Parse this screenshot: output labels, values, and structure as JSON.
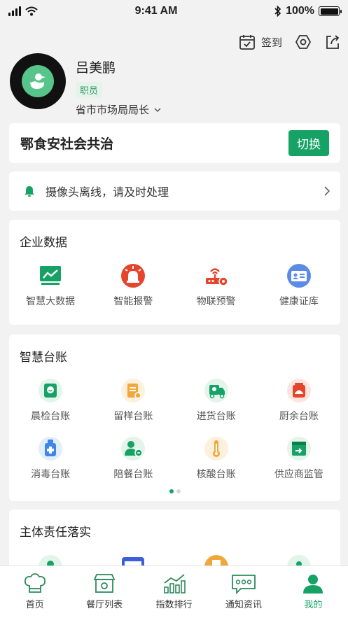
{
  "status_bar": {
    "time": "9:41 AM",
    "battery": "100%"
  },
  "top_actions": {
    "checkin_label": "签到"
  },
  "profile": {
    "name": "吕美鹏",
    "role": "职员",
    "org": "省市市场局局长"
  },
  "platform": {
    "name": "鄂食安社会共治",
    "switch_label": "切换"
  },
  "notice": {
    "text": "摄像头离线，请及时处理"
  },
  "enterprise": {
    "title": "企业数据",
    "items": [
      {
        "label": "智慧大数据",
        "icon": "chart-board-icon"
      },
      {
        "label": "智能报警",
        "icon": "alarm-icon"
      },
      {
        "label": "物联预警",
        "icon": "iot-router-icon"
      },
      {
        "label": "健康证库",
        "icon": "id-card-icon"
      }
    ]
  },
  "ledger": {
    "title": "智慧台账",
    "items": [
      {
        "label": "晨检台账",
        "icon": "morning-check-icon"
      },
      {
        "label": "留样台账",
        "icon": "sample-icon"
      },
      {
        "label": "进货台账",
        "icon": "truck-icon"
      },
      {
        "label": "厨余台账",
        "icon": "kitchen-waste-icon"
      },
      {
        "label": "消毒台账",
        "icon": "disinfect-icon"
      },
      {
        "label": "陪餐台账",
        "icon": "meal-icon"
      },
      {
        "label": "核酸台账",
        "icon": "thermometer-icon"
      },
      {
        "label": "供应商监管",
        "icon": "supplier-box-icon"
      }
    ]
  },
  "duty": {
    "title": "主体责任落实"
  },
  "tabs": [
    {
      "label": "首页",
      "icon": "chef-hat-icon"
    },
    {
      "label": "餐厅列表",
      "icon": "restaurant-icon"
    },
    {
      "label": "指数排行",
      "icon": "ranking-chart-icon"
    },
    {
      "label": "通知资讯",
      "icon": "message-icon"
    },
    {
      "label": "我的",
      "icon": "user-icon"
    }
  ],
  "colors": {
    "accent": "#16a265",
    "background": "#f2f2f2"
  }
}
